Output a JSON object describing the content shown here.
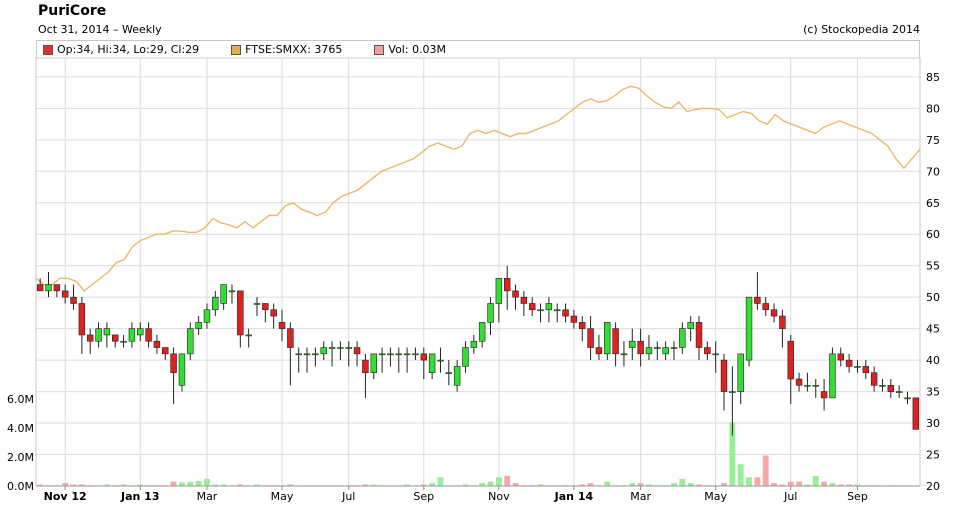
{
  "header": {
    "title": "PuriCore",
    "subtitle": "Oct 31, 2014  – Weekly",
    "credit": "(c) Stockopedia 2014"
  },
  "legend": [
    {
      "label": "Op:34, Hi:34, Lo:29, Cl:29",
      "color": "#e03030"
    },
    {
      "label": "FTSE:SMXX: 3765",
      "color": "#e0b050"
    },
    {
      "label": "Vol: 0.03M",
      "color": "#f4a0a0"
    }
  ],
  "chart_data": {
    "type": "candlestick",
    "frequency": "weekly",
    "colors": {
      "up": "#33dd33",
      "down": "#dd2222",
      "index_line": "#e8b86a",
      "vol_up": "#99ee99",
      "vol_down": "#f5a8a8"
    },
    "price_axis": {
      "min": 20,
      "max": 88,
      "ticks": [
        20,
        25,
        30,
        35,
        40,
        45,
        50,
        55,
        60,
        65,
        70,
        75,
        80,
        85
      ]
    },
    "volume_axis": {
      "min": 0,
      "max": 6.0,
      "unit": "M",
      "ticks": [
        "0.0M",
        "2.0M",
        "4.0M",
        "6.0M"
      ]
    },
    "x_labels": [
      {
        "label": "Nov 12",
        "index": 3,
        "bold": true
      },
      {
        "label": "Jan 13",
        "index": 12,
        "bold": true
      },
      {
        "label": "Mar",
        "index": 20,
        "bold": false
      },
      {
        "label": "May",
        "index": 29,
        "bold": false
      },
      {
        "label": "Jul",
        "index": 37,
        "bold": false
      },
      {
        "label": "Sep",
        "index": 46,
        "bold": false
      },
      {
        "label": "Nov",
        "index": 55,
        "bold": false
      },
      {
        "label": "Jan 14",
        "index": 64,
        "bold": true
      },
      {
        "label": "Mar",
        "index": 72,
        "bold": false
      },
      {
        "label": "May",
        "index": 81,
        "bold": false
      },
      {
        "label": "Jul",
        "index": 90,
        "bold": false
      },
      {
        "label": "Sep",
        "index": 98,
        "bold": false
      }
    ],
    "candles": [
      [
        52,
        53,
        51,
        51
      ],
      [
        51,
        54,
        50,
        52
      ],
      [
        52,
        52,
        50,
        51
      ],
      [
        51,
        52,
        49,
        50
      ],
      [
        50,
        52,
        48,
        49
      ],
      [
        49,
        50,
        41,
        44
      ],
      [
        44,
        45,
        41,
        43
      ],
      [
        43,
        46,
        42,
        45
      ],
      [
        44,
        46,
        42,
        45
      ],
      [
        44,
        44,
        42,
        43
      ],
      [
        43,
        44,
        42,
        43
      ],
      [
        43,
        46,
        42,
        45
      ],
      [
        44,
        46,
        43,
        45
      ],
      [
        45,
        46,
        42,
        43
      ],
      [
        43,
        44,
        41,
        42
      ],
      [
        42,
        42,
        40,
        41
      ],
      [
        41,
        42,
        33,
        38
      ],
      [
        36,
        41,
        35,
        41
      ],
      [
        41,
        46,
        40,
        45
      ],
      [
        45,
        47,
        44,
        46
      ],
      [
        46,
        49,
        45,
        48
      ],
      [
        48,
        51,
        47,
        50
      ],
      [
        49,
        52,
        48,
        52
      ],
      [
        51,
        52,
        49,
        51
      ],
      [
        51,
        51,
        42,
        44
      ],
      [
        44,
        45,
        42,
        44
      ],
      [
        49,
        50,
        47,
        49
      ],
      [
        49,
        49,
        46,
        48
      ],
      [
        48,
        49,
        45,
        47
      ],
      [
        46,
        48,
        43,
        45
      ],
      [
        45,
        46,
        36,
        42
      ],
      [
        41,
        42,
        38,
        41
      ],
      [
        41,
        42,
        38,
        41
      ],
      [
        41,
        42,
        39,
        41
      ],
      [
        41,
        43,
        40,
        42
      ],
      [
        42,
        43,
        39,
        42
      ],
      [
        42,
        43,
        40,
        42
      ],
      [
        42,
        43,
        39,
        42
      ],
      [
        42,
        43,
        39,
        41
      ],
      [
        40,
        41,
        34,
        38
      ],
      [
        38,
        41,
        37,
        41
      ],
      [
        41,
        42,
        38,
        41
      ],
      [
        41,
        42,
        39,
        41
      ],
      [
        41,
        42,
        38,
        41
      ],
      [
        41,
        42,
        38,
        41
      ],
      [
        41,
        42,
        40,
        41
      ],
      [
        41,
        42,
        37,
        40
      ],
      [
        38,
        41,
        37,
        41
      ],
      [
        40,
        42,
        38,
        40
      ],
      [
        38,
        40,
        36,
        38
      ],
      [
        36,
        40,
        35,
        39
      ],
      [
        39,
        43,
        38,
        42
      ],
      [
        42,
        44,
        41,
        43
      ],
      [
        43,
        46,
        42,
        46
      ],
      [
        46,
        50,
        44,
        49
      ],
      [
        49,
        53,
        46,
        53
      ],
      [
        53,
        55,
        48,
        51
      ],
      [
        51,
        52,
        48,
        50
      ],
      [
        50,
        51,
        47,
        49
      ],
      [
        49,
        50,
        47,
        48
      ],
      [
        48,
        49,
        46,
        48
      ],
      [
        48,
        50,
        46,
        49
      ],
      [
        48,
        49,
        46,
        48
      ],
      [
        48,
        49,
        46,
        47
      ],
      [
        47,
        48,
        45,
        46
      ],
      [
        46,
        47,
        43,
        45
      ],
      [
        45,
        47,
        40,
        42
      ],
      [
        42,
        44,
        40,
        41
      ],
      [
        41,
        46,
        40,
        46
      ],
      [
        45,
        46,
        39,
        41
      ],
      [
        41,
        43,
        39,
        41
      ],
      [
        42,
        45,
        40,
        43
      ],
      [
        43,
        45,
        39,
        41
      ],
      [
        41,
        44,
        40,
        42
      ],
      [
        42,
        43,
        40,
        42
      ],
      [
        41,
        43,
        40,
        42
      ],
      [
        42,
        43,
        40,
        42
      ],
      [
        42,
        46,
        41,
        45
      ],
      [
        45,
        47,
        43,
        46
      ],
      [
        46,
        47,
        40,
        42
      ],
      [
        42,
        43,
        40,
        41
      ],
      [
        41,
        43,
        38,
        41
      ],
      [
        40,
        41,
        32,
        35
      ],
      [
        35,
        39,
        28,
        35
      ],
      [
        35,
        41,
        33,
        41
      ],
      [
        40,
        50,
        39,
        50
      ],
      [
        50,
        54,
        48,
        49
      ],
      [
        49,
        50,
        47,
        48
      ],
      [
        48,
        49,
        46,
        47
      ],
      [
        47,
        48,
        42,
        45
      ],
      [
        43,
        44,
        33,
        37
      ],
      [
        37,
        38,
        35,
        36
      ],
      [
        36,
        38,
        35,
        36
      ],
      [
        36,
        37,
        34,
        36
      ],
      [
        35,
        37,
        32,
        34
      ],
      [
        34,
        42,
        34,
        41
      ],
      [
        41,
        42,
        39,
        40
      ],
      [
        40,
        41,
        38,
        39
      ],
      [
        39,
        40,
        38,
        39
      ],
      [
        39,
        40,
        37,
        38
      ],
      [
        38,
        39,
        35,
        36
      ],
      [
        36,
        37,
        35,
        36
      ],
      [
        36,
        37,
        34,
        35
      ],
      [
        35,
        36,
        34,
        35
      ],
      [
        34,
        35,
        33,
        34
      ],
      [
        34,
        34,
        29,
        29
      ]
    ],
    "volumes": [
      0.1,
      0.05,
      0.05,
      0.2,
      0.1,
      0.1,
      0.05,
      0.05,
      0.1,
      0.05,
      0.1,
      0.05,
      0.1,
      0.05,
      0.05,
      0.05,
      0.3,
      0.25,
      0.3,
      0.35,
      0.5,
      0.1,
      0.1,
      0.05,
      0.1,
      0.05,
      0.1,
      0.05,
      0.05,
      0.05,
      0.1,
      0.05,
      0.05,
      0.05,
      0.05,
      0.05,
      0.05,
      0.05,
      0.05,
      0.1,
      0.1,
      0.05,
      0.05,
      0.05,
      0.1,
      0.05,
      0.1,
      0.2,
      0.6,
      0.05,
      0.05,
      0.1,
      0.05,
      0.2,
      0.3,
      0.6,
      0.7,
      0.2,
      0.05,
      0.05,
      0.1,
      0.05,
      0.05,
      0.05,
      0.05,
      0.1,
      0.2,
      0.05,
      0.3,
      0.05,
      0.05,
      0.2,
      0.2,
      0.1,
      0.05,
      0.05,
      0.2,
      0.5,
      0.2,
      0.1,
      0.05,
      0.05,
      0.2,
      4.4,
      1.5,
      0.6,
      0.6,
      2.1,
      0.2,
      0.1,
      0.3,
      0.3,
      0.1,
      0.7,
      0.3,
      0.2,
      0.1,
      0.1,
      0.1,
      0.05,
      0.05,
      0.05,
      0.05,
      0.05,
      0.05,
      0.03,
      0.03
    ],
    "index_line": [
      53,
      52,
      52,
      53,
      53,
      52.5,
      51,
      52,
      53,
      54,
      55.5,
      56,
      58,
      59,
      59.5,
      60,
      60,
      60.5,
      60.5,
      60.3,
      60.3,
      61,
      62.5,
      61.8,
      61.5,
      61,
      62,
      61,
      62,
      63,
      63,
      64.5,
      65,
      64,
      63.5,
      63,
      63.5,
      65,
      66,
      66.5,
      67,
      68,
      69,
      70,
      70.5,
      71,
      71.5,
      72,
      73,
      74,
      74.5,
      74,
      73.5,
      74,
      76,
      76.5,
      76,
      76.5,
      76,
      75.5,
      76,
      76,
      76.5,
      77,
      77.5,
      78,
      79,
      80,
      81,
      81.5,
      81,
      81.2,
      82,
      83,
      83.5,
      83.2,
      82,
      81,
      80.3,
      80,
      81,
      79.5,
      79.8,
      80,
      80,
      79.8,
      78.5,
      79,
      79.5,
      79.2,
      78,
      77.5,
      79,
      78,
      77.5,
      77,
      76.5,
      76,
      77,
      77.5,
      78,
      77.5,
      77,
      76.5,
      76,
      75,
      74,
      72,
      70.5,
      72,
      73.5
    ]
  }
}
